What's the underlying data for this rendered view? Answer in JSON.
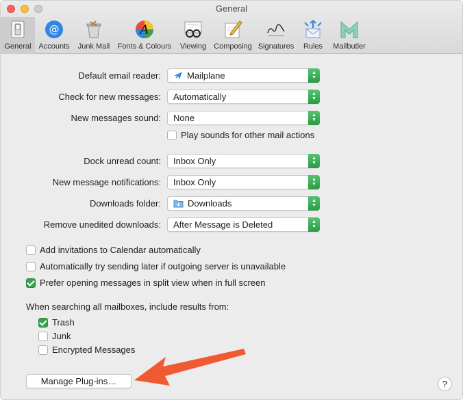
{
  "window": {
    "title": "General"
  },
  "toolbar": {
    "items": [
      {
        "label": "General",
        "icon": "switch-icon",
        "active": true
      },
      {
        "label": "Accounts",
        "icon": "at-sign-icon"
      },
      {
        "label": "Junk Mail",
        "icon": "junk-bin-icon"
      },
      {
        "label": "Fonts & Colours",
        "icon": "font-palette-icon"
      },
      {
        "label": "Viewing",
        "icon": "glasses-icon"
      },
      {
        "label": "Composing",
        "icon": "pencil-note-icon"
      },
      {
        "label": "Signatures",
        "icon": "signature-icon"
      },
      {
        "label": "Rules",
        "icon": "rules-envelope-icon"
      },
      {
        "label": "Mailbutler",
        "icon": "mailbutler-icon"
      }
    ]
  },
  "settings": {
    "default_reader": {
      "label": "Default email reader:",
      "value": "Mailplane"
    },
    "check_messages": {
      "label": "Check for new messages:",
      "value": "Automatically"
    },
    "new_sound": {
      "label": "New messages sound:",
      "value": "None"
    },
    "play_sounds": {
      "label": "Play sounds for other mail actions",
      "checked": false
    },
    "dock_unread": {
      "label": "Dock unread count:",
      "value": "Inbox Only"
    },
    "notifications": {
      "label": "New message notifications:",
      "value": "Inbox Only"
    },
    "downloads_folder": {
      "label": "Downloads folder:",
      "value": "Downloads"
    },
    "remove_downloads": {
      "label": "Remove unedited downloads:",
      "value": "After Message is Deleted"
    }
  },
  "options": {
    "calendar": {
      "label": "Add invitations to Calendar automatically",
      "checked": false
    },
    "send_later": {
      "label": "Automatically try sending later if outgoing server is unavailable",
      "checked": false
    },
    "split_view": {
      "label": "Prefer opening messages in split view when in full screen",
      "checked": true
    }
  },
  "search": {
    "heading": "When searching all mailboxes, include results from:",
    "trash": {
      "label": "Trash",
      "checked": true
    },
    "junk": {
      "label": "Junk",
      "checked": false
    },
    "encrypted": {
      "label": "Encrypted Messages",
      "checked": false
    }
  },
  "buttons": {
    "plugins": "Manage Plug-ins…",
    "help": "?"
  },
  "colors": {
    "accent_green": "#3aa14f",
    "arrow": "#ef5a33"
  }
}
